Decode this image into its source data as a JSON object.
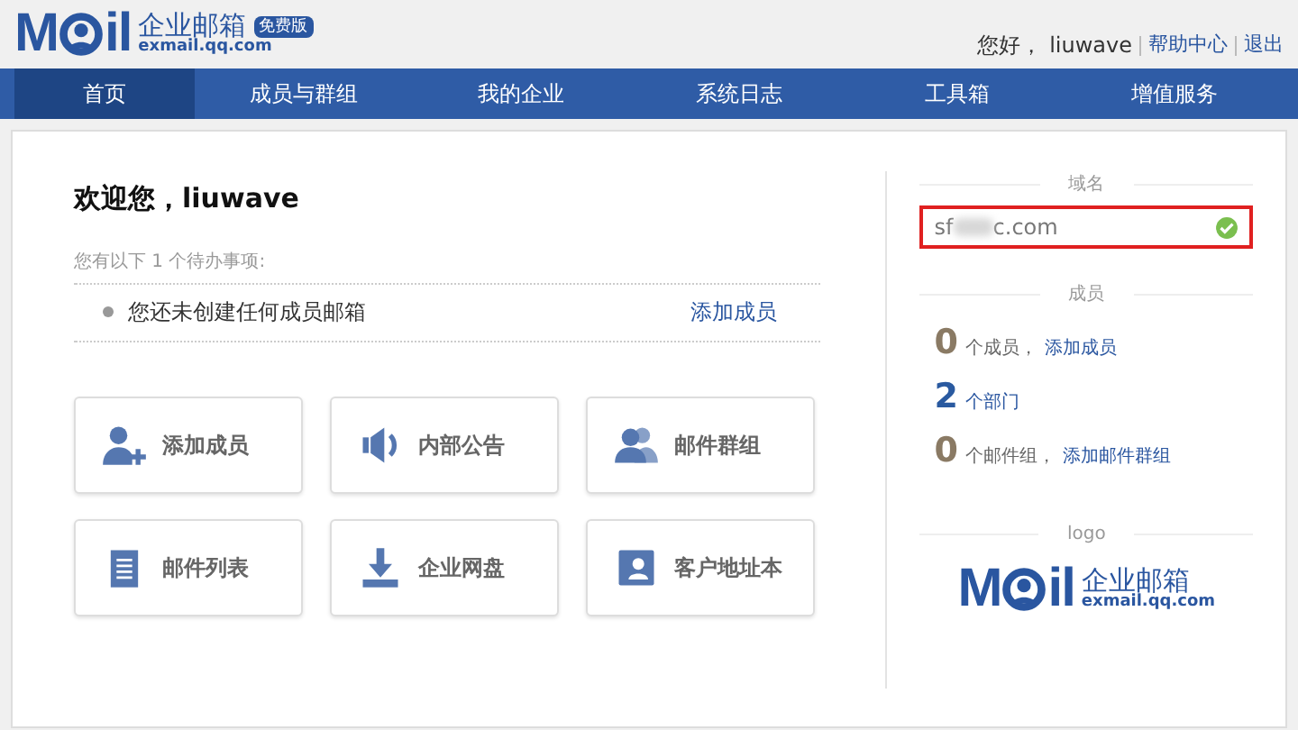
{
  "header": {
    "logo_letters": [
      "M",
      "il"
    ],
    "logo_title": "企业邮箱",
    "edition_badge": "免费版",
    "logo_domain": "exmail.qq.com",
    "greeting": "您好，",
    "username": "liuwave",
    "links": [
      "帮助中心",
      "退出"
    ]
  },
  "nav": [
    {
      "label": "首页",
      "selected": true
    },
    {
      "label": "成员与群组",
      "selected": false
    },
    {
      "label": "我的企业",
      "selected": false
    },
    {
      "label": "系统日志",
      "selected": false
    },
    {
      "label": "工具箱",
      "selected": false
    },
    {
      "label": "增值服务",
      "selected": false
    }
  ],
  "welcome": {
    "title": "欢迎您，liuwave",
    "todo_intro": "您有以下 1 个待办事项:",
    "todos": [
      {
        "text": "您还未创建任何成员邮箱",
        "action": "添加成员"
      }
    ]
  },
  "shortcuts": [
    {
      "kind": "add-user",
      "label": "添加成员"
    },
    {
      "kind": "speaker",
      "label": "内部公告"
    },
    {
      "kind": "group",
      "label": "邮件群组"
    },
    {
      "kind": "list",
      "label": "邮件列表"
    },
    {
      "kind": "download",
      "label": "企业网盘"
    },
    {
      "kind": "contact",
      "label": "客户地址本"
    }
  ],
  "sidebar": {
    "domain_heading": "域名",
    "domain": {
      "prefix": "sf",
      "suffix": "c.com",
      "verified": true,
      "highlighted": true
    },
    "members_heading": "成员",
    "stats": [
      {
        "count": "0",
        "text": "个成员，",
        "link": "添加成员",
        "color": "#8a7a64"
      },
      {
        "count": "2",
        "link": "个部门",
        "color": "#2a5aa0"
      },
      {
        "count": "0",
        "text": "个邮件组，",
        "link": "添加邮件群组",
        "color": "#8a7a64"
      }
    ],
    "logo_heading": "logo",
    "logo": {
      "letters": [
        "M",
        "il"
      ],
      "title": "企业邮箱",
      "domain": "exmail.qq.com"
    }
  }
}
